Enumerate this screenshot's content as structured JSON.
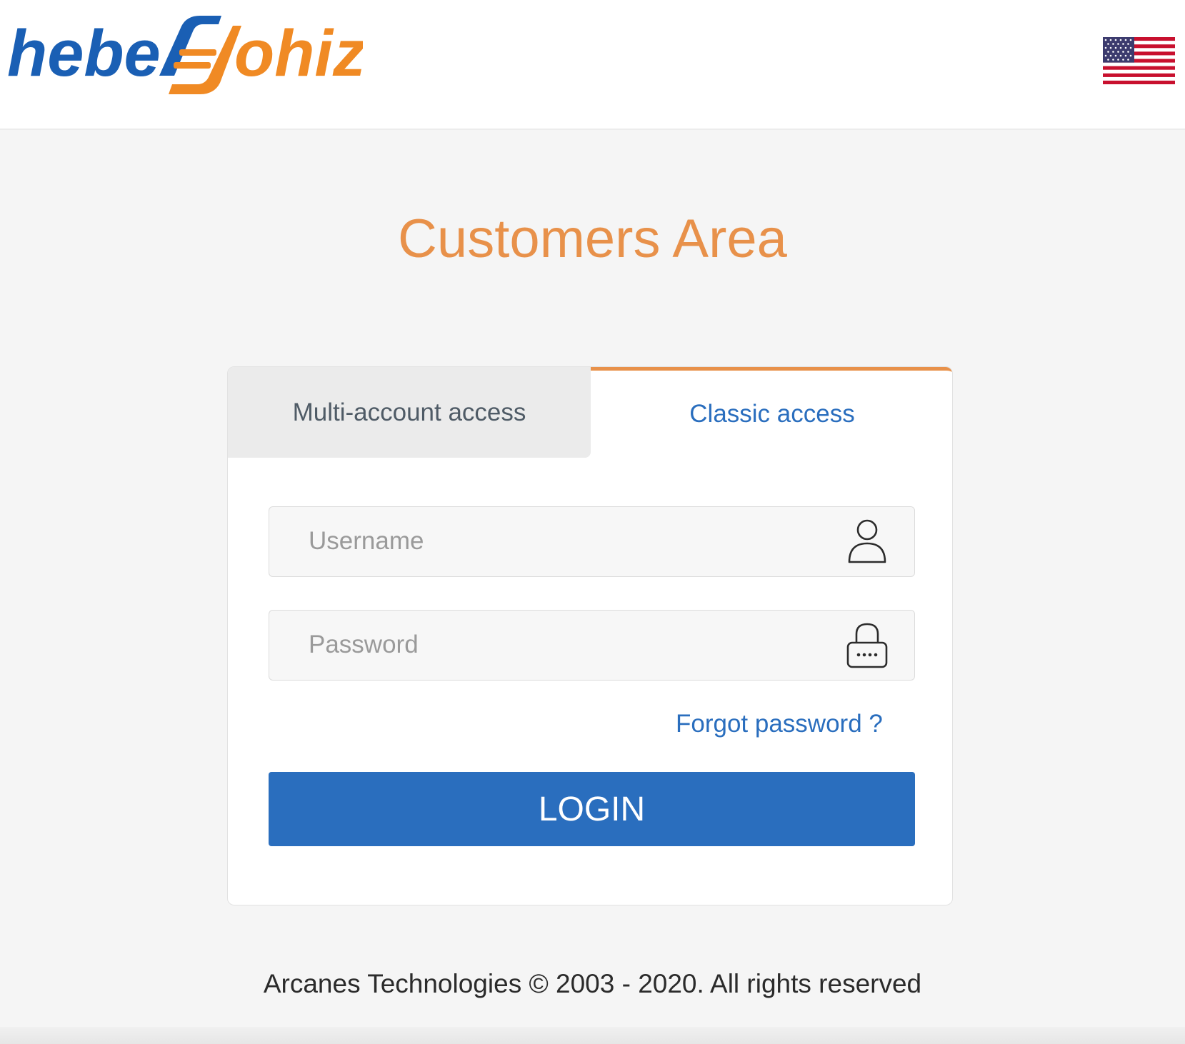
{
  "header": {
    "logo": {
      "part1": "hebe",
      "part2": "ohiz",
      "primary_color": "#1a5fb4",
      "accent_color": "#f08a24"
    },
    "language_flag": "us-flag-icon"
  },
  "main": {
    "title": "Customers Area"
  },
  "tabs": [
    {
      "label": "Multi-account access",
      "active": false
    },
    {
      "label": "Classic access",
      "active": true
    }
  ],
  "form": {
    "username": {
      "placeholder": "Username",
      "value": "",
      "icon": "user-icon"
    },
    "password": {
      "placeholder": "Password",
      "value": "",
      "icon": "lock-icon"
    },
    "forgot_label": "Forgot password ?",
    "login_label": "LOGIN"
  },
  "footer": {
    "text": "Arcanes Technologies © 2003 - 2020. All rights reserved"
  },
  "colors": {
    "accent": "#e8914a",
    "primary": "#2a6ebe",
    "background": "#f5f5f5"
  }
}
